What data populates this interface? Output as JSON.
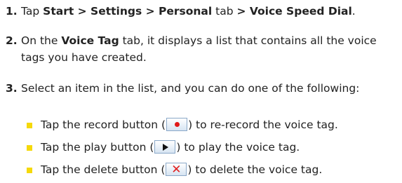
{
  "steps": [
    {
      "number": "1.",
      "parts": [
        {
          "t": "Tap ",
          "b": false
        },
        {
          "t": "Start > Settings > Personal",
          "b": true
        },
        {
          "t": " tab ",
          "b": false
        },
        {
          "t": "> Voice Speed Dial",
          "b": true
        },
        {
          "t": ".",
          "b": false
        }
      ]
    },
    {
      "number": "2.",
      "parts": [
        {
          "t": "On the ",
          "b": false
        },
        {
          "t": "Voice Tag",
          "b": true
        },
        {
          "t": " tab, it displays a list that contains all the voice tags you have created.",
          "b": false
        }
      ]
    },
    {
      "number": "3.",
      "parts": [
        {
          "t": "Select an item in the list, and you can do one of the following:",
          "b": false
        }
      ]
    }
  ],
  "bullets": [
    {
      "before": "Tap the record button (",
      "icon": "record-icon",
      "after": ") to re-record the voice tag."
    },
    {
      "before": "Tap the play button (",
      "icon": "play-icon",
      "after": ") to play the voice tag."
    },
    {
      "before": "Tap the delete button (",
      "icon": "delete-icon",
      "after": ") to delete the voice tag."
    }
  ],
  "delete_glyph": "✕",
  "colors": {
    "bullet": "#f5d90a",
    "record": "#e01818",
    "delete": "#e02020"
  }
}
